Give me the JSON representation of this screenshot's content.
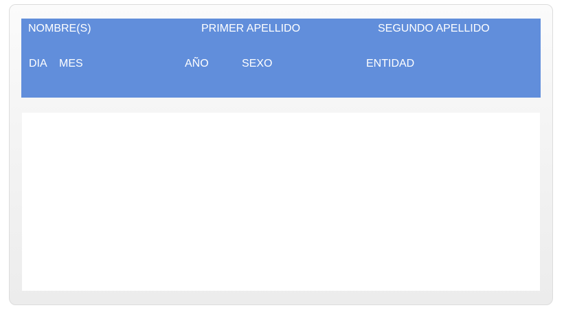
{
  "form": {
    "labels": {
      "nombres": "NOMBRE(S)",
      "primer_apellido": "PRIMER APELLIDO",
      "segundo_apellido": "SEGUNDO APELLIDO",
      "dia": "DIA",
      "mes": "MES",
      "anio": "AÑO",
      "sexo": "SEXO",
      "entidad": "ENTIDAD"
    }
  },
  "colors": {
    "header_background": "#618edb",
    "header_text": "#ffffff",
    "panel_background": "#ffffff"
  }
}
